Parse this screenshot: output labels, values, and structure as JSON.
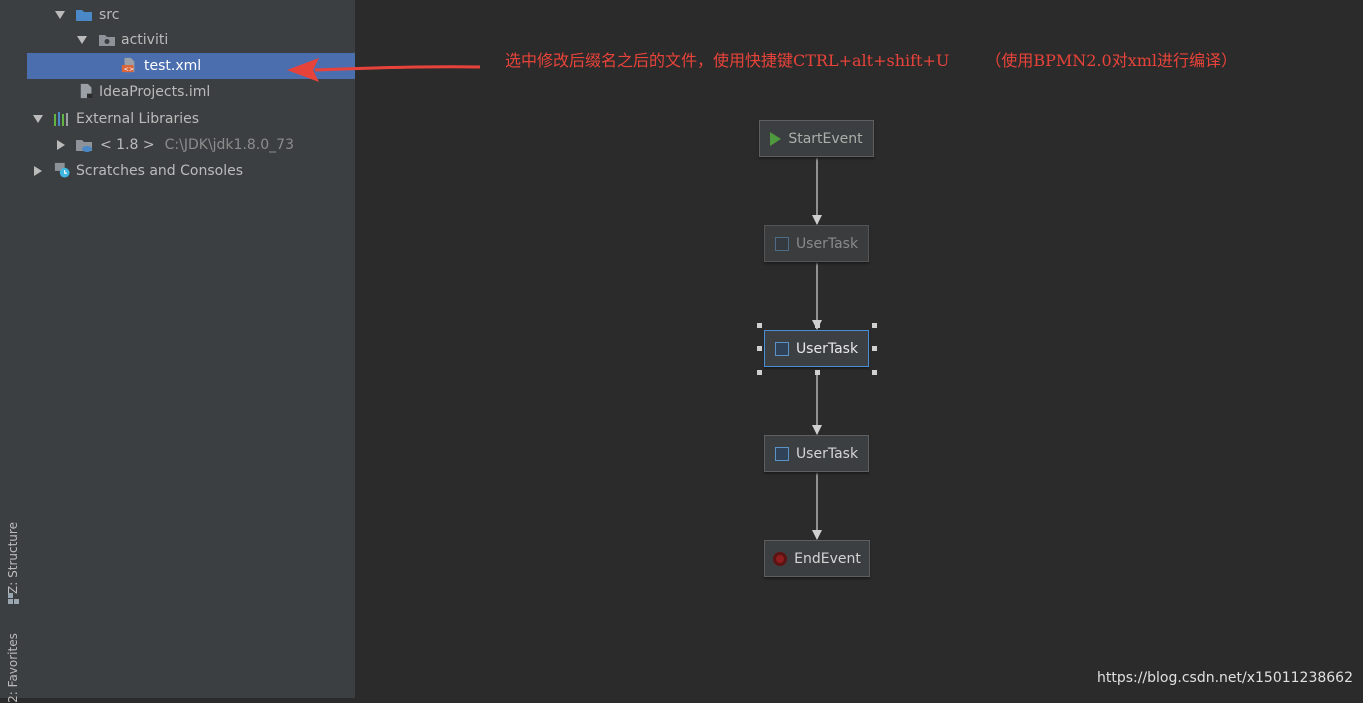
{
  "left_stripe": {
    "structure_label": "Z: Structure",
    "favorites_label": "2: Favorites"
  },
  "project_tree": {
    "items": [
      {
        "label": "src",
        "icon": "source-folder-icon",
        "expanded": true
      },
      {
        "label": "activiti",
        "icon": "package-folder-icon",
        "expanded": true
      },
      {
        "label": "test.xml",
        "icon": "xml-file-icon",
        "selected": true
      },
      {
        "label": "IdeaProjects.iml",
        "icon": "iml-file-icon"
      },
      {
        "label": "External Libraries",
        "icon": "libraries-icon",
        "expanded": true
      },
      {
        "label": "< 1.8 >",
        "path": "C:\\JDK\\jdk1.8.0_73",
        "icon": "jdk-icon",
        "expanded": false
      },
      {
        "label": "Scratches and Consoles",
        "icon": "scratches-icon",
        "expanded": false
      }
    ]
  },
  "annotation": {
    "text": "选中修改后缀名之后的文件，使用快捷键CTRL+alt+shift+U",
    "note": "（使用BPMN2.0对xml进行编译）",
    "color": "#e8433a"
  },
  "diagram": {
    "nodes": [
      {
        "label": "StartEvent",
        "kind": "start-event"
      },
      {
        "label": "UserTask",
        "kind": "user-task",
        "state": "faded"
      },
      {
        "label": "UserTask",
        "kind": "user-task",
        "state": "selected"
      },
      {
        "label": "UserTask",
        "kind": "user-task",
        "state": "normal"
      },
      {
        "label": "EndEvent",
        "kind": "end-event"
      }
    ]
  },
  "watermark": "https://blog.csdn.net/x15011238662",
  "colors": {
    "editor_bg": "#2b2b2b",
    "panel_bg": "#3c3f41",
    "selection": "#4b6eaf",
    "annotation_red": "#e8433a"
  }
}
